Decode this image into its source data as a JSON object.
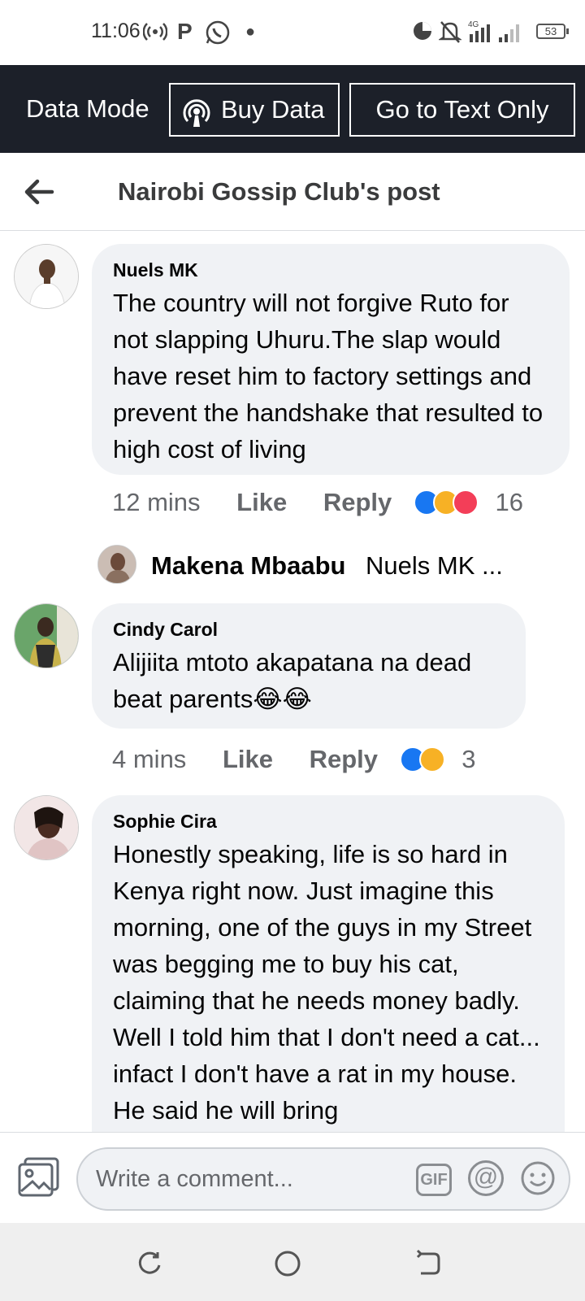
{
  "status_bar": {
    "time": "11:06",
    "battery": "53",
    "icons": [
      "hotspot-icon",
      "p-app-icon",
      "whatsapp-icon",
      "dot-icon",
      "data-saver-icon",
      "mute-icon",
      "signal-4g-icon",
      "signal-icon",
      "battery-icon"
    ]
  },
  "data_bar": {
    "mode_label": "Data Mode",
    "buy_data_label": "Buy Data",
    "text_only_label": "Go to Text Only"
  },
  "header": {
    "title": "Nairobi Gossip Club's post"
  },
  "comments": [
    {
      "author": "Nuels MK",
      "text": "The country will not forgive Ruto for not slapping Uhuru.The slap would have reset him to factory settings and prevent  the handshake that resulted to  high cost of living",
      "time": "12 mins",
      "like_label": "Like",
      "reply_label": "Reply",
      "reactions": [
        "like",
        "haha",
        "love"
      ],
      "reaction_count": "16",
      "reply_preview": {
        "name": "Makena Mbaabu",
        "snippet": "Nuels MK ..."
      }
    },
    {
      "author": "Cindy Carol",
      "text": "Alijiita mtoto akapatana na dead beat parents😂😂",
      "time": "4 mins",
      "like_label": "Like",
      "reply_label": "Reply",
      "reactions": [
        "like",
        "haha"
      ],
      "reaction_count": "3"
    },
    {
      "author": "Sophie Cira",
      "text": "Honestly speaking, life is so hard in Kenya right now. Just imagine this morning, one of the guys in my Street was begging me to buy his cat, claiming that he needs money badly. Well I told him that I don't need a cat... infact I don't have a rat in my house. He said he will bring"
    }
  ],
  "composer": {
    "placeholder": "Write a comment...",
    "gif_label": "GIF",
    "at_label": "@"
  },
  "colors": {
    "data_bar_bg": "#1c2029",
    "bubble_bg": "#f0f2f5",
    "like_blue": "#1877f2",
    "haha_yellow": "#f7b125",
    "love_red": "#f33e58"
  }
}
